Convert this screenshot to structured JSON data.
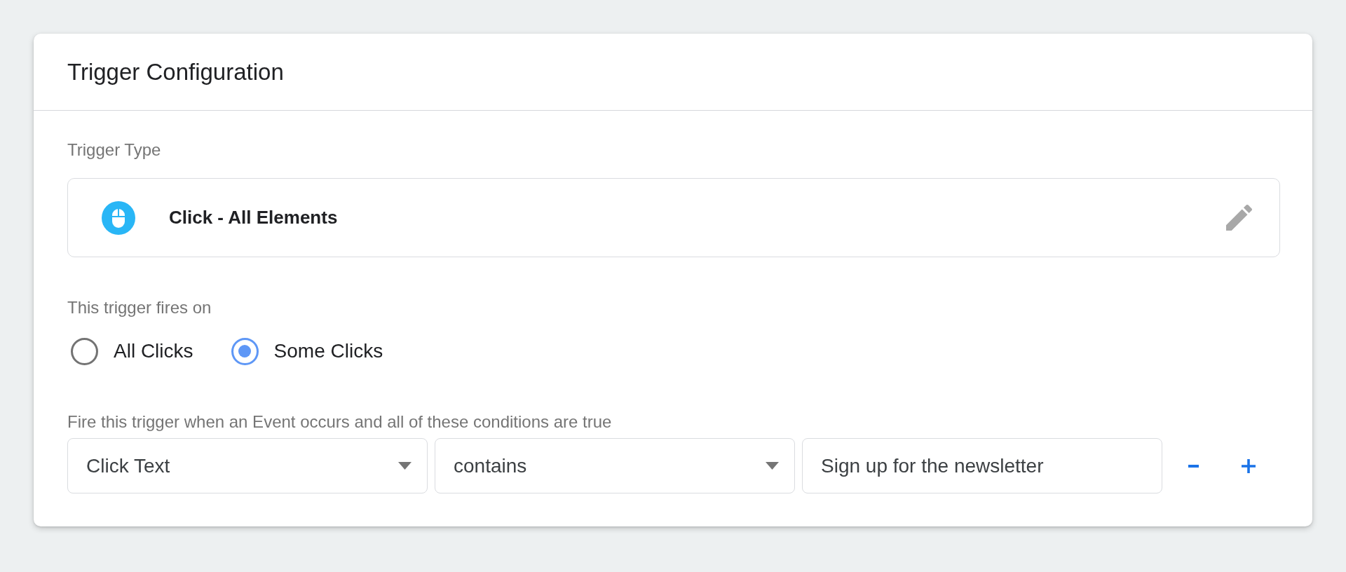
{
  "panel": {
    "title": "Trigger Configuration"
  },
  "trigger_type": {
    "label": "Trigger Type",
    "name": "Click - All Elements"
  },
  "fires_on": {
    "label": "This trigger fires on",
    "options": [
      {
        "label": "All Clicks",
        "selected": false
      },
      {
        "label": "Some Clicks",
        "selected": true
      }
    ]
  },
  "conditions": {
    "label": "Fire this trigger when an Event occurs and all of these conditions are true",
    "rows": [
      {
        "fields": [
          {
            "kind": "dropdown",
            "value": "Click Text"
          },
          {
            "kind": "dropdown",
            "value": "contains"
          },
          {
            "kind": "text",
            "value": "Sign up for the newsletter"
          }
        ]
      }
    ]
  }
}
